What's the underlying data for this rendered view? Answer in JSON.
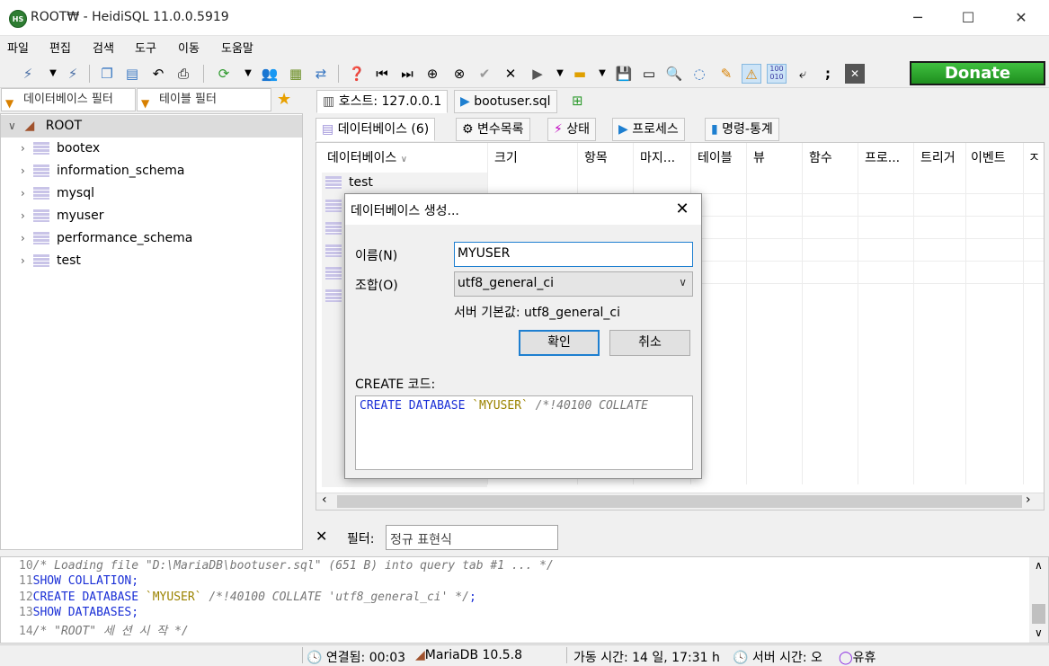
{
  "window": {
    "icon_text": "HS",
    "title": "ROOT₩ - HeidiSQL 11.0.0.5919",
    "minimize": "─",
    "maximize": "☐",
    "close": "✕"
  },
  "menu": [
    "파일",
    "편집",
    "검색",
    "도구",
    "이동",
    "도움말"
  ],
  "toolbar": {
    "donate_label": "Donate",
    "icons": [
      "connect-icon",
      "dropdown-icon",
      "disconnect-icon",
      "copy-icon",
      "paste-icon",
      "undo-icon",
      "print-icon",
      "refresh-icon",
      "dropdown-icon",
      "user-manager-icon",
      "export-icon",
      "sync-icon",
      "help-icon",
      "first-icon",
      "last-icon",
      "add-icon",
      "remove-icon",
      "apply-icon",
      "cancel-icon",
      "run-icon",
      "dropdown-icon",
      "folder-icon",
      "dropdown-icon",
      "save-icon",
      "save-as-icon",
      "find-icon",
      "replace-icon",
      "clean-icon",
      "warning-icon",
      "binary-icon",
      "wrap-icon",
      "semicolon-icon",
      "close-tab-icon"
    ]
  },
  "filters": {
    "database_filter": "데이터베이스 필터",
    "table_filter": "테이블 필터"
  },
  "tree": {
    "root": "ROOT",
    "items": [
      "bootex",
      "information_schema",
      "mysql",
      "myuser",
      "performance_schema",
      "test"
    ]
  },
  "main_tabs": [
    {
      "label": "호스트: 127.0.0.1"
    },
    {
      "label": "bootuser.sql"
    }
  ],
  "sub_tabs": [
    {
      "label": "데이터베이스 (6)"
    },
    {
      "label": "변수목록"
    },
    {
      "label": "상태"
    },
    {
      "label": "프로세스"
    },
    {
      "label": "명령-통계"
    }
  ],
  "grid": {
    "headers": [
      "데이터베이스",
      "크기",
      "항목",
      "마지...",
      "테이블",
      "뷰",
      "함수",
      "프로...",
      "트리거",
      "이벤트",
      "ㅈ"
    ],
    "first_row": "test"
  },
  "filter_row": {
    "label": "필터:",
    "placeholder": "정규 표현식"
  },
  "log": [
    {
      "n": "10",
      "parts": [
        {
          "t": "/* Loading file \"D:\\MariaDB\\bootuser.sql\" (651 B) into query tab #1 ... */",
          "c": "cm"
        }
      ]
    },
    {
      "n": "11",
      "parts": [
        {
          "t": "SHOW COLLATION;",
          "c": "kw"
        }
      ]
    },
    {
      "n": "12",
      "parts": [
        {
          "t": "CREATE DATABASE ",
          "c": "kw"
        },
        {
          "t": "`MYUSER`",
          "c": "str"
        },
        {
          "t": " /*!40100 COLLATE 'utf8_general_ci' */",
          "c": "cm"
        },
        {
          "t": ";",
          "c": "kw"
        }
      ]
    },
    {
      "n": "13",
      "parts": [
        {
          "t": "SHOW DATABASES;",
          "c": "kw"
        }
      ]
    },
    {
      "n": "14",
      "parts": [
        {
          "t": "/* \"ROOT\" 세 션  시 작  */",
          "c": "cm"
        }
      ]
    }
  ],
  "status": {
    "connected": "연결됨: 00:03",
    "server": "MariaDB 10.5.8",
    "uptime": "가동 시간: 14 일, 17:31 h",
    "server_time": "서버 시간: 오",
    "idle": "유휴"
  },
  "dialog": {
    "title": "데이터베이스 생성...",
    "name_label": "이름(N)",
    "name_value": "MYUSER",
    "collation_label": "조합(O)",
    "collation_value": "utf8_general_ci",
    "server_default": "서버 기본값: utf8_general_ci",
    "ok_label": "확인",
    "cancel_label": "취소",
    "create_code_label": "CREATE 코드:",
    "code_keyword": "CREATE DATABASE ",
    "code_name": "`MYUSER`",
    "code_comment": " /*!40100 COLLATE"
  }
}
